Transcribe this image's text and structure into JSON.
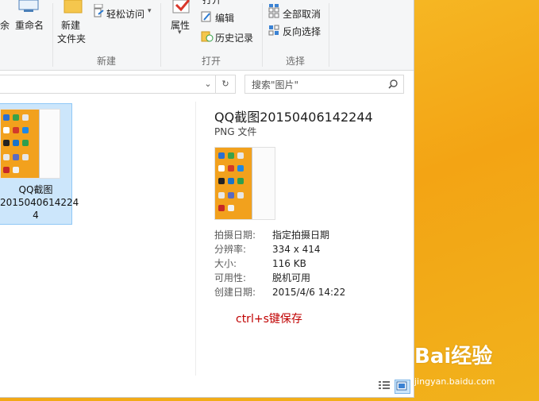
{
  "ribbon": {
    "delete_label": "余",
    "rename_label": "重命名",
    "new_folder_label_1": "新建",
    "new_folder_label_2": "文件夹",
    "easy_access_label": "轻松访问",
    "group_new": "新建",
    "properties_label": "属性",
    "open_label": "打开",
    "edit_label": "编辑",
    "history_label": "历史记录",
    "group_open": "打开",
    "select_none_label": "全部取消",
    "invert_selection_label": "反向选择",
    "group_select": "选择"
  },
  "address": {
    "search_placeholder": "搜索\"图片\""
  },
  "file": {
    "name_line1": "QQ截图",
    "name_line2": "2015040614224",
    "name_line3": "4"
  },
  "preview": {
    "title": "QQ截图20150406142244",
    "type": "PNG 文件",
    "properties": [
      {
        "key": "拍摄日期:",
        "value": "指定拍摄日期"
      },
      {
        "key": "分辨率:",
        "value": "334 x 414"
      },
      {
        "key": "大小:",
        "value": "116 KB"
      },
      {
        "key": "可用性:",
        "value": "脱机可用"
      },
      {
        "key": "创建日期:",
        "value": "2015/4/6 14:22"
      }
    ],
    "note": "ctrl+s键保存"
  },
  "watermark": {
    "brand": "Bai经验",
    "url": "jingyan.baidu.com"
  },
  "colors": {
    "accent": "#0a65c2",
    "selection": "#cce6fb",
    "note": "#c00000",
    "desktop": "#f3a414"
  }
}
